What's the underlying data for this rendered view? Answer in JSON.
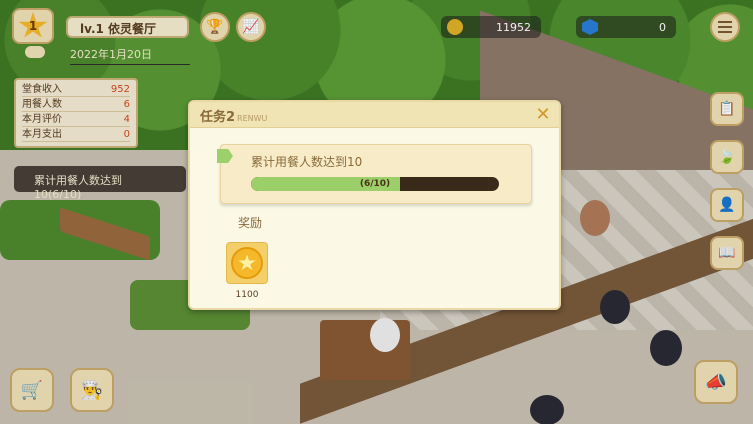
{
  "header": {
    "level": "1",
    "restaurant_name": "lv.1 依灵餐厅",
    "date": "2022年1月20日",
    "coins": "11952",
    "gems": "0"
  },
  "stats": [
    {
      "label": "堂食收入",
      "value": "952"
    },
    {
      "label": "用餐人数",
      "value": "6"
    },
    {
      "label": "本月评价",
      "value": "4"
    },
    {
      "label": "本月支出",
      "value": "0"
    }
  ],
  "task_banner": "累计用餐人数达到10(6/10)",
  "modal": {
    "title": "任务2",
    "subtitle": "RENWU",
    "close": "✕",
    "task_text": "累计用餐人数达到10",
    "progress_text": "(6/10)",
    "progress_value": 0.6,
    "reward_label": "奖励",
    "reward_amount": "1100"
  },
  "icons": {
    "trophy": "trophy-icon",
    "chart": "chart-icon",
    "menu": "menu-icon",
    "cart": "cart-icon",
    "chef": "chef-hat-icon",
    "megaphone": "megaphone-icon"
  },
  "colors": {
    "panel": "#f3ead4",
    "accent": "#f5b82a",
    "progress": "#9ccf6a"
  }
}
